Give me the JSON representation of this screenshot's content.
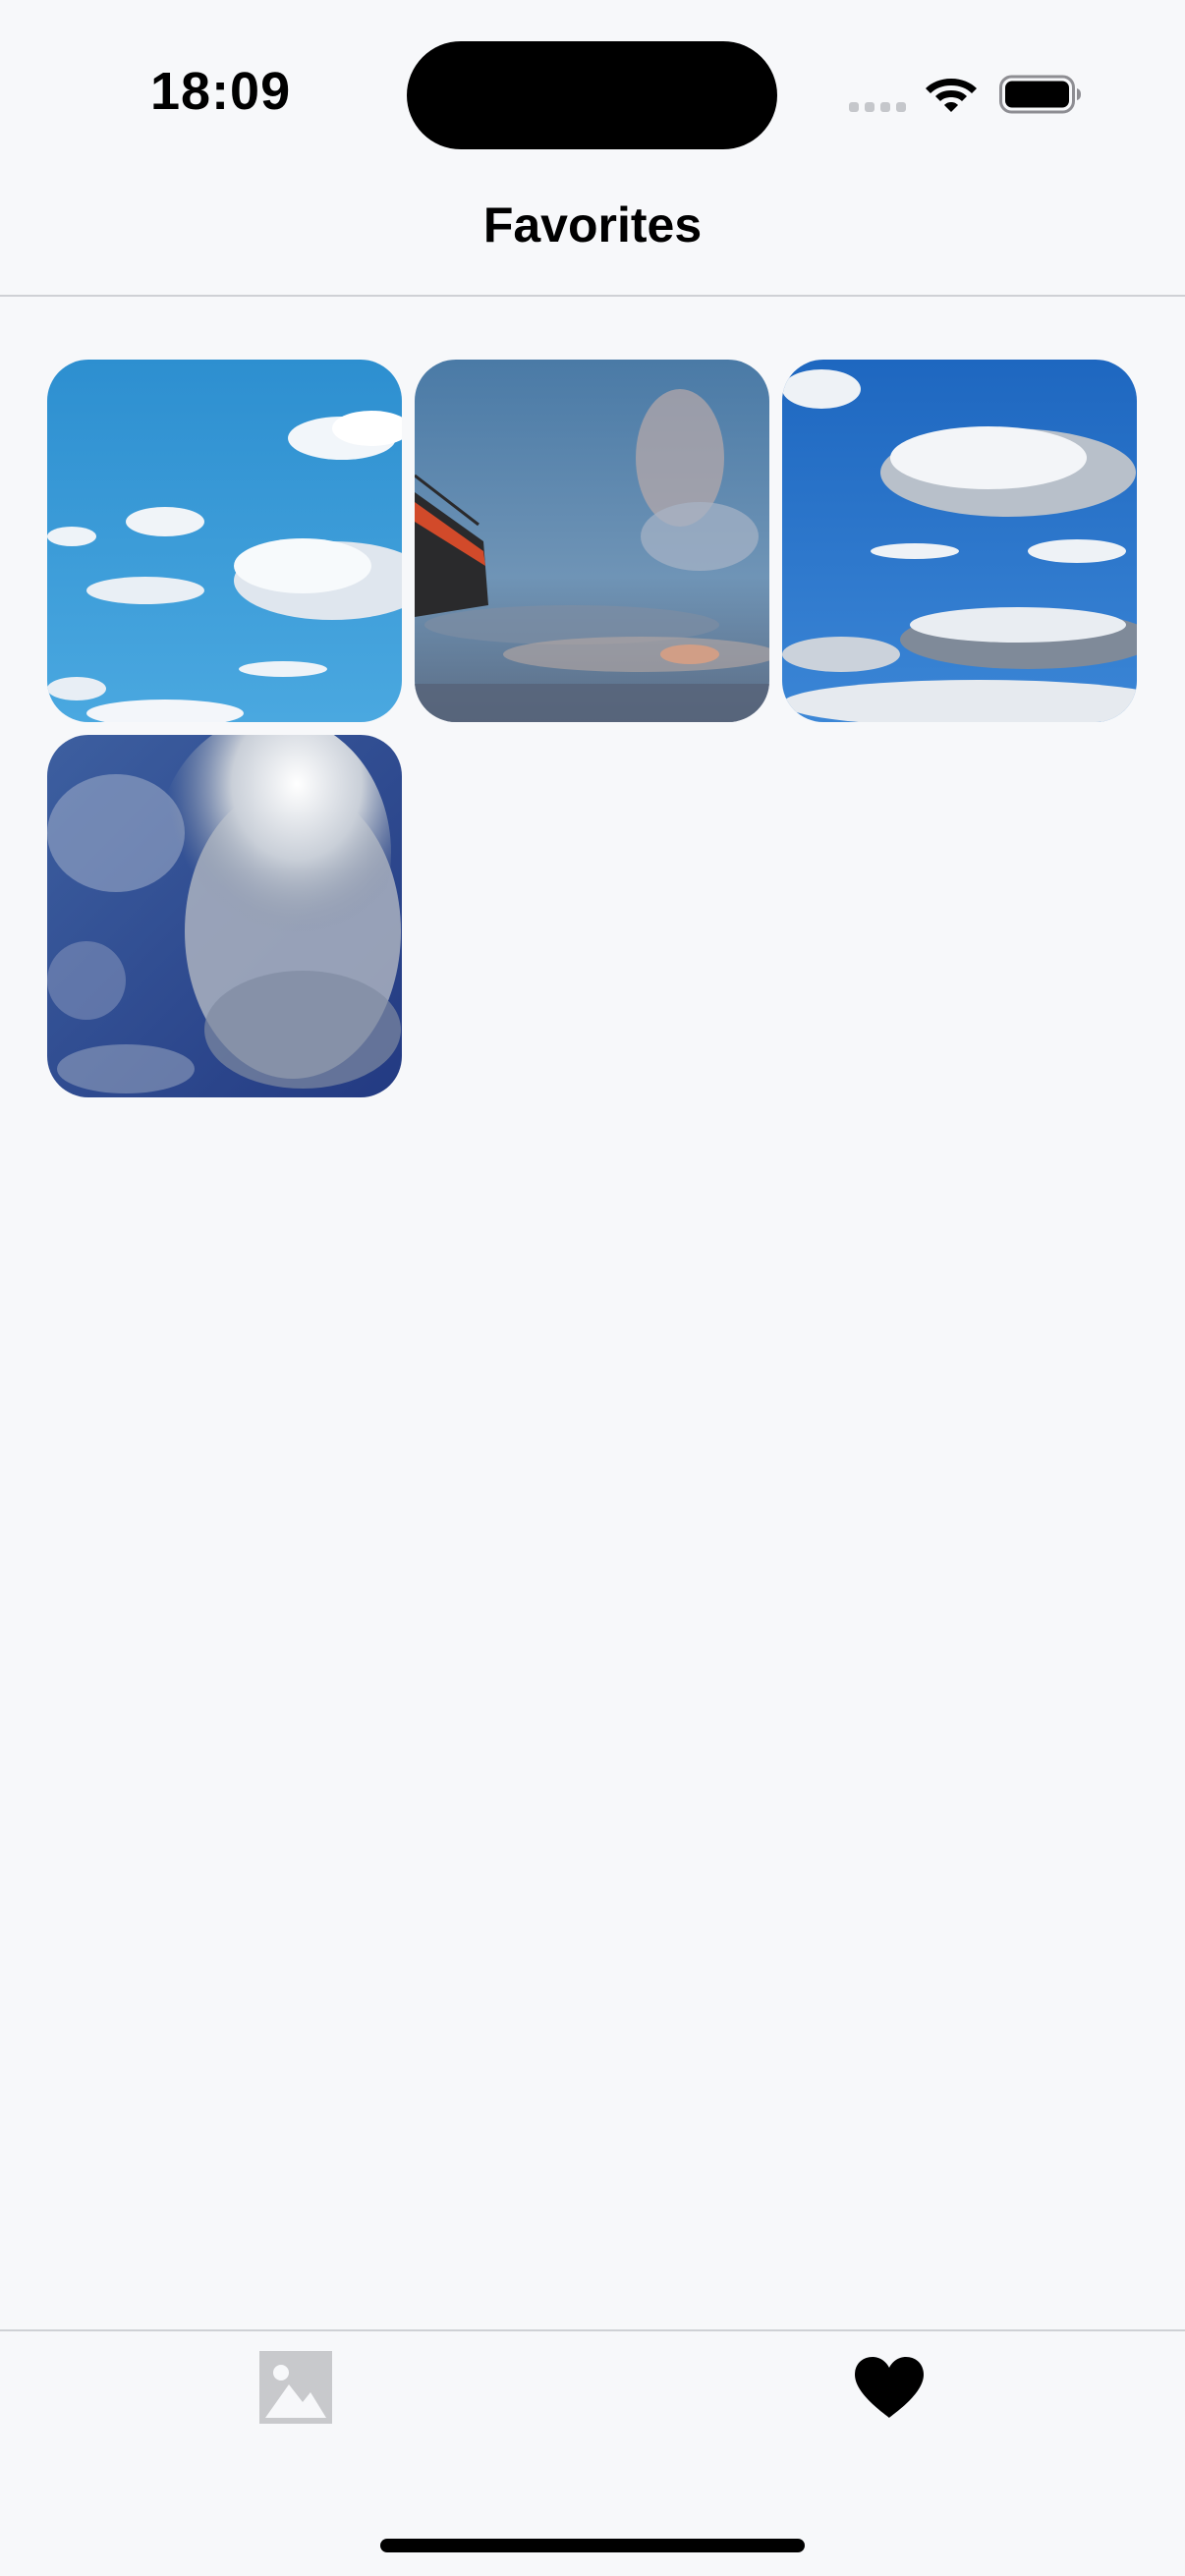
{
  "status_bar": {
    "time": "18:09"
  },
  "header": {
    "title": "Favorites"
  },
  "photos": [
    {
      "icon": "photo-sky-clouds-1"
    },
    {
      "icon": "photo-sky-dusk-building"
    },
    {
      "icon": "photo-sky-clouds-3"
    },
    {
      "icon": "photo-sky-clouds-4"
    }
  ],
  "tab_bar": {
    "tabs": [
      {
        "icon": "photo-icon",
        "selected": false
      },
      {
        "icon": "heart-icon",
        "selected": true
      }
    ]
  },
  "colors": {
    "background": "#f7f8fa",
    "divider": "#cfd1d5",
    "inactive_tab": "#c8c9cc",
    "active_tab": "#000000"
  }
}
